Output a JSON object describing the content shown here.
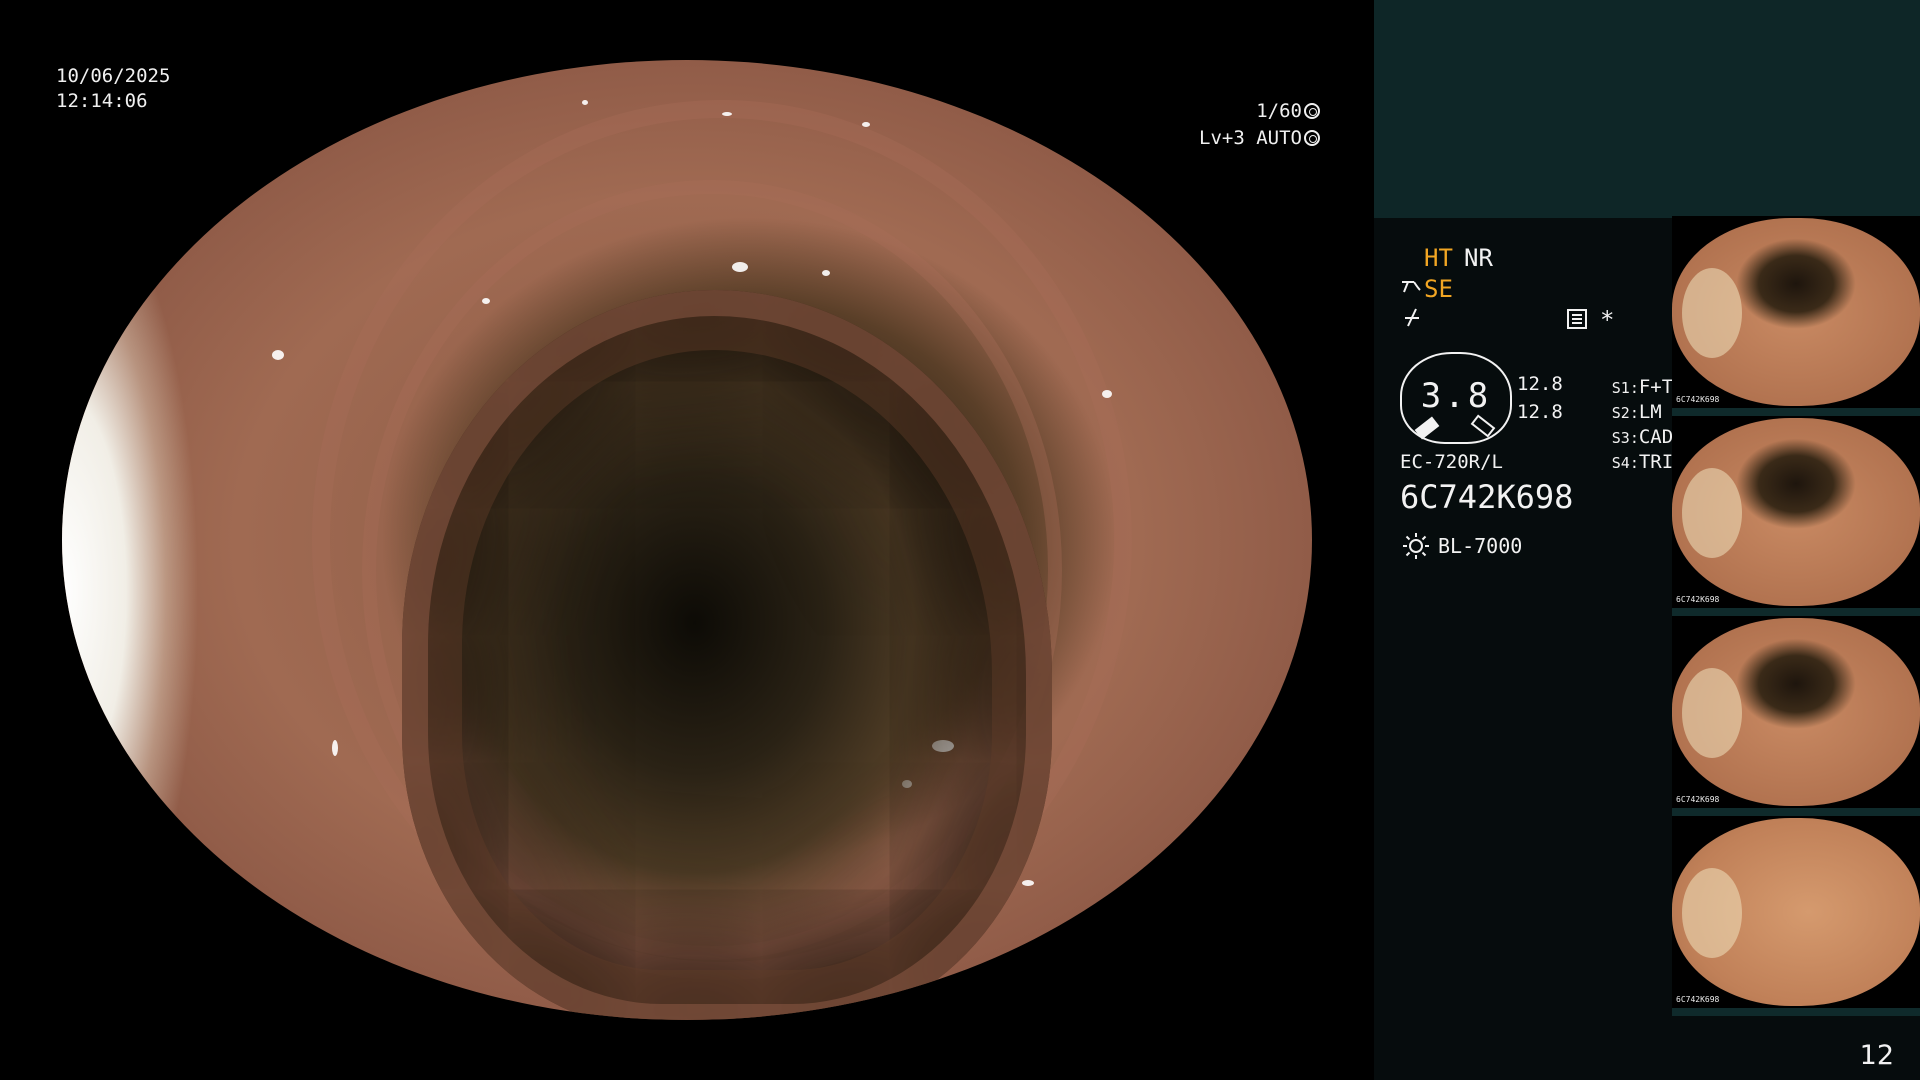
{
  "osd": {
    "date": "10/06/2025",
    "time": "12:14:06",
    "shutter": "1/60",
    "level": "Lv+3",
    "mode": "AUTO"
  },
  "panel": {
    "ht": "HT",
    "nr": "NR",
    "se": "SE",
    "asterisk": "*",
    "gauge_value": "3.8",
    "gauge_side_top": "12.8",
    "gauge_side_bottom": "12.8",
    "switches": [
      {
        "key": "S1:",
        "value": "F+T"
      },
      {
        "key": "S2:",
        "value": "LM"
      },
      {
        "key": "S3:",
        "value": "CAD"
      },
      {
        "key": "S4:",
        "value": "TRIG"
      }
    ],
    "scope_model": "EC-720R/L",
    "scope_serial": "6C742K698",
    "light_source": "BL-7000"
  },
  "thumbnails": [
    {
      "caption": "6C742K698"
    },
    {
      "caption": "6C742K698"
    },
    {
      "caption": "6C742K698"
    },
    {
      "caption": "6C742K698"
    }
  ],
  "page_number": "12",
  "colors": {
    "accent_orange": "#f2a623",
    "panel_top": "#0e2627",
    "panel_bg": "#060c0d"
  }
}
